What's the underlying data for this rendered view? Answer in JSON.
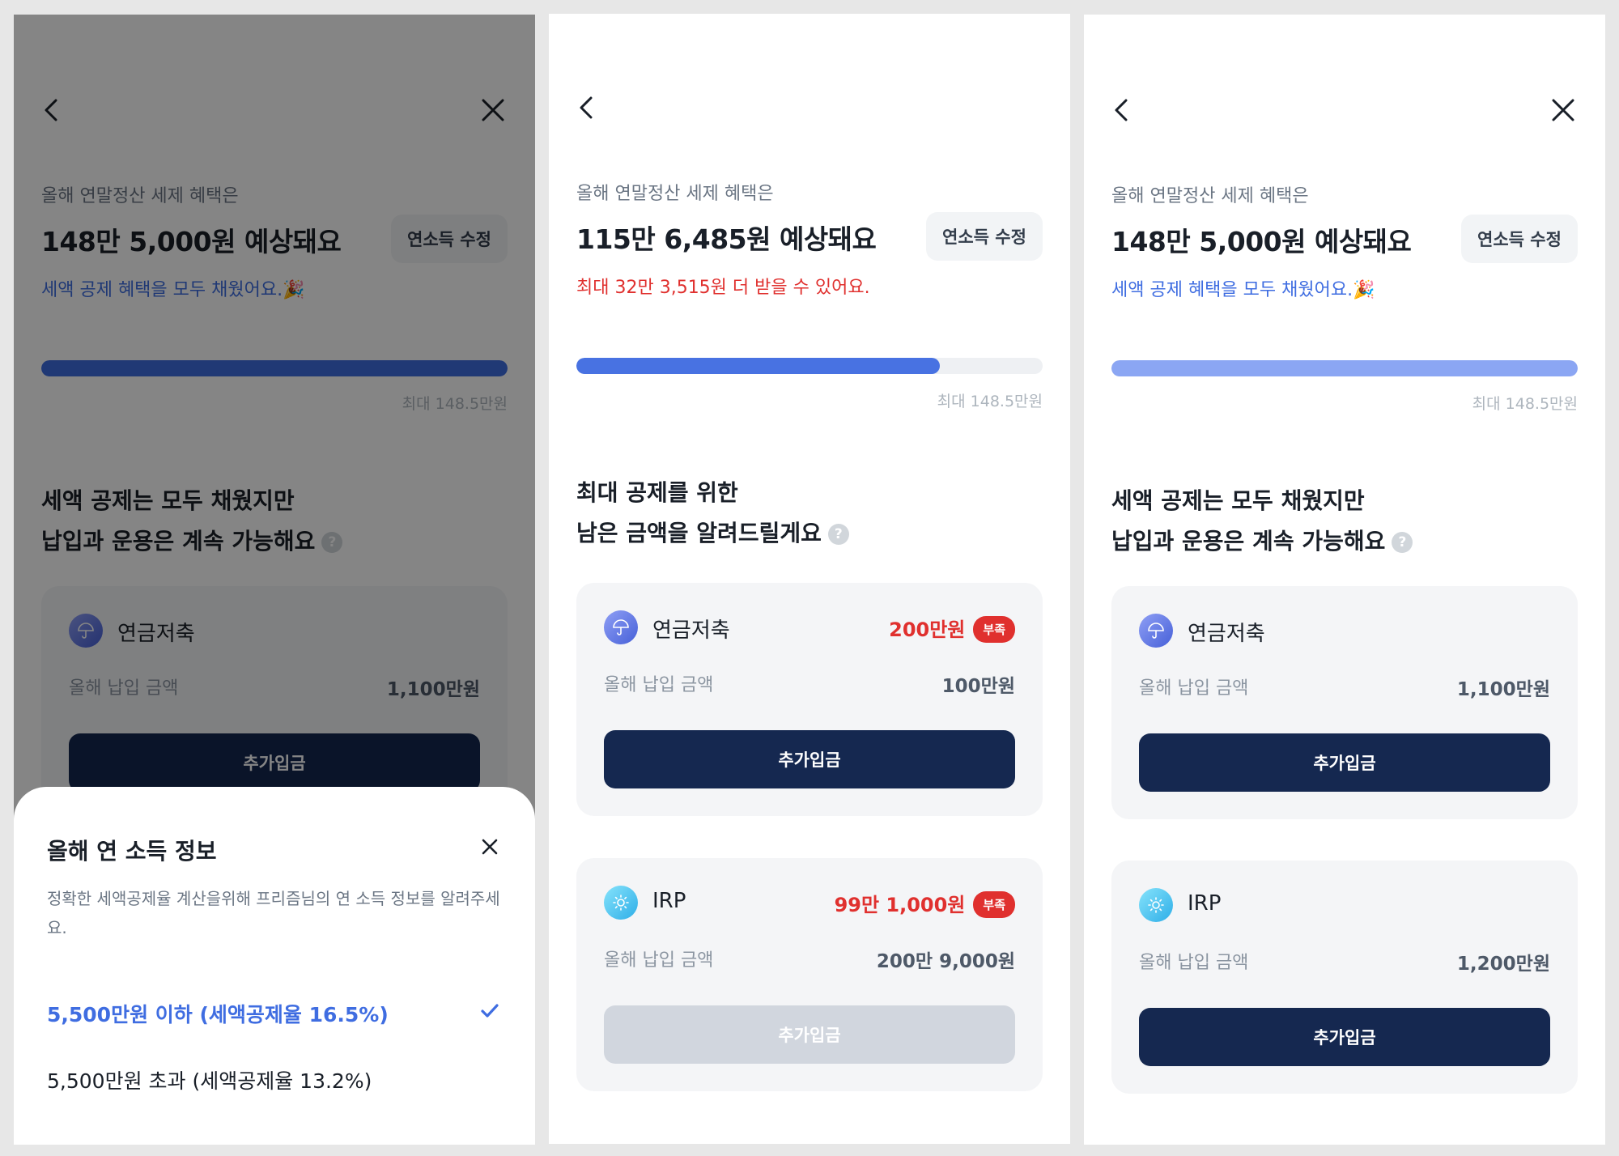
{
  "colors": {
    "accent_blue": "#3f6de1",
    "alert_red": "#e0302e",
    "navy_button": "#152850"
  },
  "screens": [
    {
      "summary_label": "올해 연말정산 세제 혜택은",
      "summary_amount": "148만 5,000원 예상돼요",
      "summary_note": "세액 공제 혜택을 모두 채웠어요.🎉",
      "income_button": "연소득 수정",
      "progress_fraction": 1.0,
      "progress_max": "최대 148.5만원",
      "section_title_line1": "세액 공제는 모두 채웠지만",
      "section_title_line2": "납입과 운용은 계속 가능해요",
      "cards": [
        {
          "icon": "umbrella-icon",
          "title": "연금저축",
          "row_label": "올해 납입 금액",
          "row_value": "1,100만원",
          "button": "추가입금"
        }
      ],
      "sheet": {
        "title": "올해 연 소득 정보",
        "description": "정확한 세액공제율 계산을위해 프리즘님의 연 소득 정보를 알려주세요.",
        "options": [
          {
            "label": "5,500만원 이하 (세액공제율 16.5%)",
            "selected": true
          },
          {
            "label": "5,500만원 초과 (세액공제율 13.2%)",
            "selected": false
          }
        ]
      }
    },
    {
      "summary_label": "올해 연말정산 세제 혜택은",
      "summary_amount": "115만 6,485원 예상돼요",
      "summary_note": "최대 32만 3,515원 더 받을 수 있어요.",
      "income_button": "연소득 수정",
      "progress_fraction": 0.78,
      "progress_max": "최대 148.5만원",
      "section_title_line1": "최대 공제를 위한",
      "section_title_line2": "남은 금액을 알려드릴게요",
      "cards": [
        {
          "icon": "umbrella-icon",
          "title": "연금저축",
          "shortage": "200만원",
          "badge": "부족",
          "row_label": "올해 납입 금액",
          "row_value": "100만원",
          "button": "추가입금",
          "disabled": false
        },
        {
          "icon": "sun-icon",
          "title": "IRP",
          "shortage": "99만 1,000원",
          "badge": "부족",
          "row_label": "올해 납입 금액",
          "row_value": "200만 9,000원",
          "button": "추가입금",
          "disabled": true
        }
      ]
    },
    {
      "summary_label": "올해 연말정산 세제 혜택은",
      "summary_amount": "148만 5,000원 예상돼요",
      "summary_note": "세액 공제 혜택을 모두 채웠어요.🎉",
      "income_button": "연소득 수정",
      "progress_fraction": 1.0,
      "progress_max": "최대 148.5만원",
      "section_title_line1": "세액 공제는 모두 채웠지만",
      "section_title_line2": "납입과 운용은 계속 가능해요",
      "cards": [
        {
          "icon": "umbrella-icon",
          "title": "연금저축",
          "row_label": "올해 납입 금액",
          "row_value": "1,100만원",
          "button": "추가입금"
        },
        {
          "icon": "sun-icon",
          "title": "IRP",
          "row_label": "올해 납입 금액",
          "row_value": "1,200만원",
          "button": "추가입금"
        }
      ]
    }
  ]
}
